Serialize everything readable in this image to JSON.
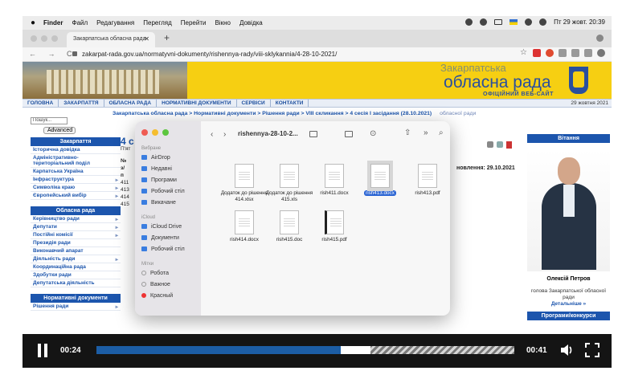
{
  "menubar": {
    "apple": "",
    "items": [
      "Finder",
      "Файл",
      "Редагування",
      "Перегляд",
      "Перейти",
      "Вікно",
      "Довідка"
    ],
    "clock": "Пт 29 жовт.  20:39"
  },
  "browser": {
    "tab_title": "Закарпатська обласна рада",
    "tab_close": "✕",
    "new_tab": "+",
    "nav": "← → C",
    "url": "zakarpat-rada.gov.ua/normatyvni-dokumenty/rishennya-rady/viii-sklykannia/4-28-10-2021/"
  },
  "site_header": {
    "line1": "Закарпатська",
    "line2": "обласна рада",
    "line3": "ОФІЦІЙНИЙ ВЕБ-САЙТ"
  },
  "site_nav": {
    "items": [
      "ГОЛОВНА",
      "ЗАКАРПАТТЯ",
      "ОБЛАСНА РАДА",
      "НОРМАТИВНІ ДОКУМЕНТИ",
      "СЕРВІСИ",
      "КОНТАКТИ"
    ],
    "date": "29 жовтня 2021"
  },
  "left": {
    "search_value": "Пошук...",
    "advanced": "Advanced",
    "sec1": "Закарпаття",
    "links1": [
      "Історична довідка",
      "Адміністративно-територіальний поділ",
      "Карпатська Україна",
      "Інфраструктура",
      "Символіка краю",
      "Європейський вибір"
    ],
    "sec2": "Обласна рада",
    "links2": [
      "Керівництво ради",
      "Депутати",
      "Постійні комісії",
      "Президія ради",
      "Виконавчий апарат",
      "Діяльність ради",
      "Координаційна рада",
      "Здобутки ради",
      "Депутатська діяльність"
    ],
    "sec3": "Нормативні документи",
    "links3": [
      "Рішення ради"
    ]
  },
  "breadcrumb": {
    "text": "Закарпатська обласна рада > Нормативні документи > Рішення ради > VIII скликання > 4 сесія І засідання (28.10.2021)",
    "extra": "обласної ради"
  },
  "main": {
    "heading": "4 с",
    "sub": "П'ят",
    "lines": [
      "№",
      "з/",
      "п",
      "411",
      "413",
      "414",
      "415"
    ],
    "updated": "новлення: 29.10.2021"
  },
  "right": {
    "header": "Вітання",
    "name": "Олексій Петров",
    "position": "голова Закарпатської обласної ради",
    "more": "Детальніше »",
    "header2": "Програми/конкурси"
  },
  "finder": {
    "title": "rishennya-28-10-2...",
    "sidebar_sec1": "Вибране",
    "fav": [
      "AirDrop",
      "Недавні",
      "Програми",
      "Робочий стіл",
      "Викачане"
    ],
    "sidebar_sec2": "iCloud",
    "cloud": [
      "iCloud Drive",
      "Документи",
      "Робочий стіл"
    ],
    "sidebar_sec3": "Мітки",
    "tags": [
      "Робота",
      "Важное",
      "Красный"
    ],
    "files": [
      {
        "name": "Додаток до рішення 414.xlsx"
      },
      {
        "name": "Додаток до рішення 415.xls"
      },
      {
        "name": "rish411.docx"
      },
      {
        "name": "rish413.docx"
      },
      {
        "name": "rish413.pdf"
      },
      {
        "name": "rish414.docx"
      },
      {
        "name": "rish415.doc"
      },
      {
        "name": "rish415.pdf"
      }
    ],
    "selected": "rish413.docx"
  },
  "player": {
    "current": "00:24",
    "total": "00:41",
    "progress_fraction": 0.585,
    "buffered_fraction": 0.655
  },
  "colors": {
    "site_blue": "#1c55ad",
    "header_yellow": "#f6cf12",
    "progress_blue": "#1c5da5"
  }
}
